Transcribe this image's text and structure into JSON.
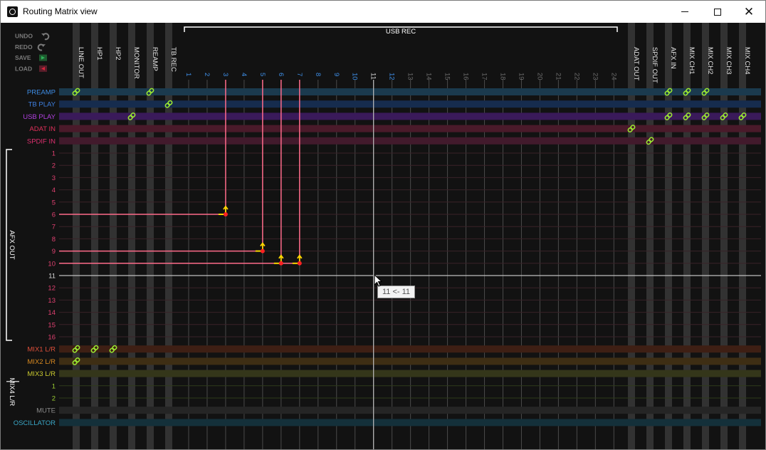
{
  "window": {
    "title": "Routing Matrix view",
    "icon": "app-logo-icon",
    "controls": [
      "minimize-icon",
      "maximize-icon",
      "close-icon"
    ]
  },
  "colors": {
    "background": "#121212",
    "column_stripe": "#3d3d3d",
    "highlight_line": "#ff6b8a",
    "cursor_line": "#bfbfbf",
    "link_icon": "#9be832",
    "arrow": "#ffd700",
    "dot": "#ff2222"
  },
  "toolbar": {
    "items": [
      {
        "label": "UNDO",
        "icon": "undo-arrow-icon",
        "color": "#7a7a7a"
      },
      {
        "label": "REDO",
        "icon": "redo-arrow-icon",
        "color": "#7a7a7a"
      },
      {
        "label": "SAVE",
        "icon": "save-icon",
        "color": "#2fb35a"
      },
      {
        "label": "LOAD",
        "icon": "load-icon",
        "color": "#d6243c"
      }
    ]
  },
  "group_labels": {
    "usb_rec": "USB REC",
    "afx_out": "AFX OUT",
    "mix4": "MIX4 L/R"
  },
  "columns": {
    "left": [
      "LINE OUT",
      "HP1",
      "HP2",
      "MONITOR",
      "REAMP",
      "TB REC"
    ],
    "usb_rec": [
      "1",
      "2",
      "3",
      "4",
      "5",
      "6",
      "7",
      "8",
      "9",
      "10",
      "11",
      "12",
      "13",
      "14",
      "15",
      "16",
      "17",
      "18",
      "19",
      "20",
      "21",
      "22",
      "23",
      "24"
    ],
    "right": [
      "ADAT OUT",
      "SPDIF OUT",
      "AFX IN",
      "MIX CH1",
      "MIX CH2",
      "MIX CH3",
      "MIX CH4"
    ]
  },
  "rows": [
    {
      "label": "PREAMP",
      "color": "#3e8ee6",
      "band": "#1b3a4e"
    },
    {
      "label": "TB PLAY",
      "color": "#3e7fe0",
      "band": "#162c4e"
    },
    {
      "label": "USB PLAY",
      "color": "#b040e0",
      "band": "#3a1a5a"
    },
    {
      "label": "ADAT IN",
      "color": "#e0305a",
      "band": "#4a1a2a"
    },
    {
      "label": "SPDIF IN",
      "color": "#e03070",
      "band": "#421a2c"
    },
    {
      "label": "1",
      "color": "#e04070"
    },
    {
      "label": "2",
      "color": "#e04070"
    },
    {
      "label": "3",
      "color": "#e04070"
    },
    {
      "label": "4",
      "color": "#e04070"
    },
    {
      "label": "5",
      "color": "#e04070"
    },
    {
      "label": "6",
      "color": "#e04070"
    },
    {
      "label": "7",
      "color": "#e04070"
    },
    {
      "label": "8",
      "color": "#e04070"
    },
    {
      "label": "9",
      "color": "#e04070"
    },
    {
      "label": "10",
      "color": "#e04070"
    },
    {
      "label": "11",
      "color": "#d9d9d9"
    },
    {
      "label": "12",
      "color": "#e04070"
    },
    {
      "label": "13",
      "color": "#e04070"
    },
    {
      "label": "14",
      "color": "#e04070"
    },
    {
      "label": "15",
      "color": "#e04070"
    },
    {
      "label": "16",
      "color": "#e04070"
    },
    {
      "label": "MIX1 L/R",
      "color": "#e0503a",
      "band": "#3e1f14"
    },
    {
      "label": "MIX2 L/R",
      "color": "#d98a20",
      "band": "#3e2e14"
    },
    {
      "label": "MIX3 L/R",
      "color": "#cccc30",
      "band": "#34361a"
    },
    {
      "label": "1",
      "color": "#9acd32"
    },
    {
      "label": "2",
      "color": "#9acd32"
    },
    {
      "label": "MUTE",
      "color": "#8a8a8a",
      "band": "#252525"
    },
    {
      "label": "OSCILLATOR",
      "color": "#3aa8c8",
      "band": "#14303a"
    }
  ],
  "links": [
    {
      "row": "PREAMP",
      "column": "LINE OUT"
    },
    {
      "row": "PREAMP",
      "column": "REAMP"
    },
    {
      "row": "PREAMP",
      "column": "AFX IN"
    },
    {
      "row": "PREAMP",
      "column": "MIX CH1"
    },
    {
      "row": "PREAMP",
      "column": "MIX CH2"
    },
    {
      "row": "TB PLAY",
      "column": "TB REC"
    },
    {
      "row": "USB PLAY",
      "column": "MONITOR"
    },
    {
      "row": "USB PLAY",
      "column": "AFX IN"
    },
    {
      "row": "USB PLAY",
      "column": "MIX CH1"
    },
    {
      "row": "USB PLAY",
      "column": "MIX CH2"
    },
    {
      "row": "USB PLAY",
      "column": "MIX CH3"
    },
    {
      "row": "USB PLAY",
      "column": "MIX CH4"
    },
    {
      "row": "ADAT IN",
      "column": "ADAT OUT"
    },
    {
      "row": "SPDIF IN",
      "column": "SPDIF OUT"
    },
    {
      "row": "MIX1 L/R",
      "column": "LINE OUT"
    },
    {
      "row": "MIX1 L/R",
      "column": "HP1"
    },
    {
      "row": "MIX1 L/R",
      "column": "HP2"
    },
    {
      "row": "MIX2 L/R",
      "column": "LINE OUT"
    }
  ],
  "routes": [
    {
      "afx_out": "6",
      "usb_rec": "3"
    },
    {
      "afx_out": "9",
      "usb_rec": "5"
    },
    {
      "afx_out": "10",
      "usb_rec": "6"
    },
    {
      "afx_out": "10",
      "usb_rec": "7"
    }
  ],
  "cursor": {
    "afx_out": "11",
    "usb_rec": "11"
  },
  "tooltip": {
    "text": "11 <- 11"
  }
}
